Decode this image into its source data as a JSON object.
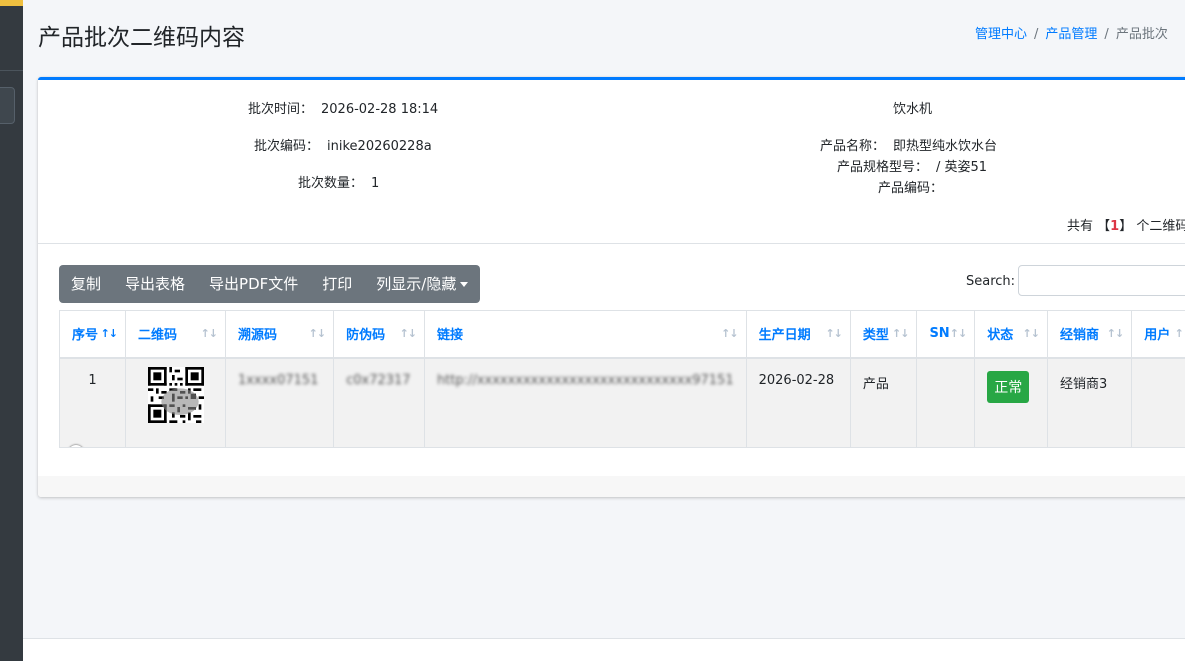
{
  "page": {
    "title": "产品批次二维码内容",
    "breadcrumb": [
      "管理中心",
      "产品管理",
      "产品批次"
    ]
  },
  "batch": {
    "time_label": "批次时间：",
    "time_value": "2026-02-28 18:14",
    "code_label": "批次编码：",
    "code_value": "inike20260228a",
    "qty_label": "批次数量：",
    "qty_value": "1"
  },
  "product": {
    "category": "饮水机",
    "name_label": "产品名称：",
    "name_value": "即热型纯水饮水台",
    "spec_label": "产品规格型号：",
    "spec_value": "/ 英姿51",
    "code_label": "产品编码：",
    "code_value": ""
  },
  "count": {
    "prefix": "共有",
    "lbracket": "【",
    "value": "1",
    "rbracket": "】",
    "suffix": "个二维码"
  },
  "toolbar": {
    "copy": "复制",
    "export_table": "导出表格",
    "export_pdf": "导出PDF文件",
    "print": "打印",
    "columns": "列显示/隐藏"
  },
  "search": {
    "label": "Search:",
    "value": ""
  },
  "table": {
    "headers": [
      "序号",
      "二维码",
      "溯源码",
      "防伪码",
      "链接",
      "生产日期",
      "类型",
      "SN",
      "状态",
      "经销商",
      "用户"
    ],
    "rows": [
      {
        "index": "1",
        "trace_code": "1xxxx07151",
        "anti_fake": "c0x72317",
        "link": "http://xxxxxxxxxxxxxxxxxxxxxxxxxxxx97151",
        "date": "2026-02-28",
        "type": "产品",
        "sn": "",
        "status": "正常",
        "dealer": "经销商3",
        "user": ""
      }
    ]
  },
  "colors": {
    "primary": "#007bff",
    "success": "#28a745",
    "sidebar": "#343a40",
    "toolbar": "#6c757d"
  },
  "icons": {
    "expand": "plus-circle-icon",
    "sort": "sort-arrows-icon",
    "dropdown": "caret-down-icon"
  }
}
